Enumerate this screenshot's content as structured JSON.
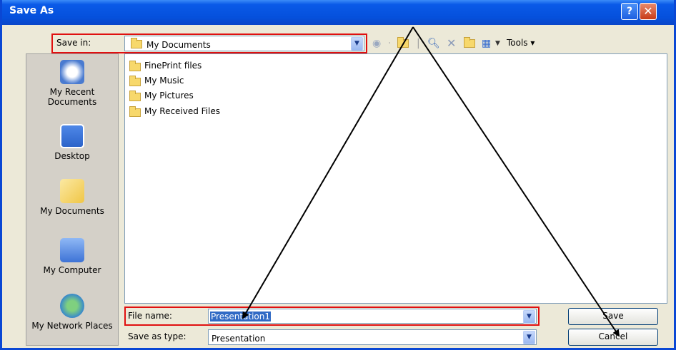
{
  "window": {
    "title": "Save As",
    "help_label": "?",
    "close_label": "✕"
  },
  "save_in": {
    "label": "Save in:",
    "value": "My Documents"
  },
  "toolbar": {
    "tools_label": "Tools ▾",
    "icons": [
      "back-icon",
      "up-folder-icon",
      "search-web-icon",
      "delete-icon",
      "new-folder-icon",
      "views-icon"
    ]
  },
  "places": [
    {
      "label": "My Recent Documents",
      "icon": "recent-documents-icon",
      "color": "#4a7bd0"
    },
    {
      "label": "Desktop",
      "icon": "desktop-icon",
      "color": "#2b63c9"
    },
    {
      "label": "My Documents",
      "icon": "my-documents-icon",
      "color": "#f4d56a"
    },
    {
      "label": "My Computer",
      "icon": "my-computer-icon",
      "color": "#5a8ee0"
    },
    {
      "label": "My Network Places",
      "icon": "network-places-icon",
      "color": "#3aa05a"
    }
  ],
  "files": [
    {
      "name": "FinePrint files"
    },
    {
      "name": "My Music"
    },
    {
      "name": "My Pictures"
    },
    {
      "name": "My Received Files"
    }
  ],
  "file_name": {
    "label": "File name:",
    "value": "Presentation1"
  },
  "save_as_type": {
    "label": "Save as type:",
    "value": "Presentation"
  },
  "buttons": {
    "save": "Save",
    "cancel": "Cancel"
  },
  "colors": {
    "title_bar": "#0550dc",
    "highlight_box": "#e01010",
    "selection": "#316ac5"
  }
}
